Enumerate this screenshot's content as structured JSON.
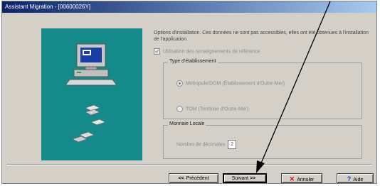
{
  "window": {
    "title": "Assistant Migration - [00600026Y]"
  },
  "intro": {
    "text": "Options d'installation. Ces données ne sont pas accessibles, elles ont été obtenues à l'installation de l'application."
  },
  "checkbox": {
    "label": "Utilisation des renseignements de référence"
  },
  "etablissement": {
    "title": "Type d'établissement",
    "options": [
      {
        "label": "Métropole/DOM (Établissement d'Outre-Mer)",
        "checked": true
      },
      {
        "label": "TOM (Territoire d'Outre-Mer)",
        "checked": false
      }
    ]
  },
  "monnaie": {
    "title": "Monnaie Locale",
    "decimals_label": "Nombre de décimales",
    "decimals_value": "2"
  },
  "buttons": {
    "precedent": {
      "glyph": "<<",
      "label": "Précédent"
    },
    "suivant": {
      "label": "Suivant",
      "glyph": ">>"
    },
    "annuler": {
      "label": "Annuler"
    },
    "aide": {
      "label": "Aide"
    }
  },
  "colors": {
    "title_bar": "#0a246a",
    "dialog_bg": "#d4d0c8",
    "graphic_bg": "#148a8a"
  }
}
